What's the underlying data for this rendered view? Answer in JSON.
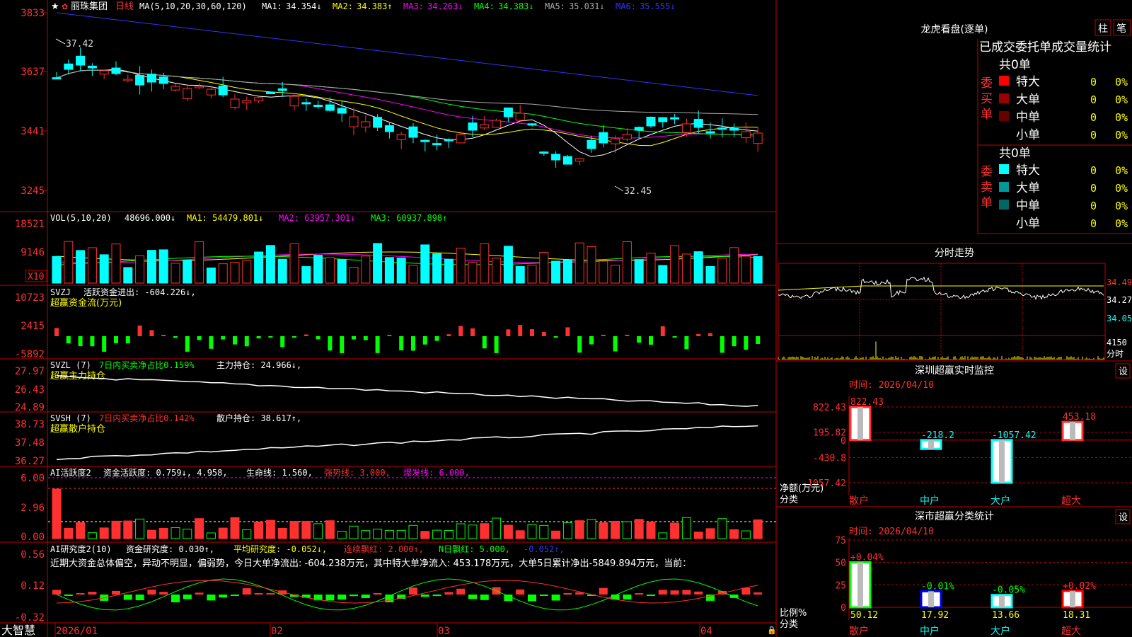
{
  "stock": {
    "name": "丽珠集团",
    "period": "日线",
    "star": "★"
  },
  "ma_header": {
    "label": "MA(5,10,20,30,60,120)",
    "items": [
      {
        "name": "MA1:",
        "value": "34.354↓",
        "color": "#ffffff"
      },
      {
        "name": "MA2:",
        "value": "34.383↑",
        "color": "#ffff00"
      },
      {
        "name": "MA3:",
        "value": "34.263↓",
        "color": "#ff00ff"
      },
      {
        "name": "MA4:",
        "value": "34.383↓",
        "color": "#00ff00"
      },
      {
        "name": "MA5:",
        "value": "35.031↓",
        "color": "#aaaaaa"
      },
      {
        "name": "MA6:",
        "value": "35.555↓",
        "color": "#3333ff"
      }
    ]
  },
  "price_axis": {
    "ticks": [
      "3833",
      "3637",
      "3441",
      "3245"
    ]
  },
  "price_annotations": {
    "high": "37.42",
    "low": "32.45"
  },
  "vol_header": {
    "label": "VOL(5,10,20)",
    "value": "48696.000↓",
    "ma1": "MA1: 54479.801↓",
    "ma2": "MA2: 63957.301↓",
    "ma3": "MA3: 60937.898↑"
  },
  "vol_axis": {
    "ticks": [
      "18521",
      "9146"
    ],
    "unit": "X10"
  },
  "svzj": {
    "label": "SVZJ",
    "desc": "活跃资金进出: -604.226↓,",
    "sub": "超赢资金流(万元)",
    "ticks": [
      "10723",
      "2415",
      "-5892"
    ]
  },
  "svzl": {
    "label": "SVZL (7)",
    "desc1": "7日内买卖净占比0.159%",
    "desc2": "主力持仓: 24.966↓,",
    "sub": "超赢主力持仓",
    "ticks": [
      "27.97",
      "26.43",
      "24.89"
    ]
  },
  "svsh": {
    "label": "SVSH (7)",
    "desc1": "7日内买卖净占比0.142%",
    "desc2": "散户持仓: 38.617↑,",
    "sub": "超赢散户持仓",
    "ticks": [
      "38.73",
      "37.48",
      "36.27"
    ]
  },
  "ai1": {
    "label": "AI活跃度2",
    "desc1": "资金活跃度: 0.759↓, 4.958,",
    "desc2": "生命线: 1.560,",
    "desc3": "强势线: 3.000,",
    "desc4": "爆发线: 6.000,",
    "ticks": [
      "6.00",
      "2.96",
      "0.00"
    ]
  },
  "ai2": {
    "label": "AI研究度2(10)",
    "desc1": "资金研究度: 0.030↑,",
    "desc2": "平均研究度: -0.052↓,",
    "desc3": "连续飘红: 2.000↑,",
    "desc4": "N日飘红: 5.000,",
    "desc5": "-0.052↑,",
    "ticks": [
      "0.56",
      "0.12",
      "-0.32"
    ]
  },
  "commentary": "近期大资金总体偏空，异动不明显，偏弱势，今日大单净流出: -604.238万元，其中特大单净流入: 453.178万元，大单5日累计净出-5849.894万元，当前：",
  "date_axis": {
    "brand": "大智慧",
    "labels": [
      "2026/01",
      "02",
      "03",
      "04"
    ]
  },
  "dragon": {
    "title": "龙虎看盘(逐单)",
    "tab1": "柱",
    "tab2": "笔",
    "subtitle": "已成交委托单成交量统计",
    "buy_label": "委买单",
    "sell_label": "委卖单",
    "buy_total": "共0单",
    "sell_total": "共0单",
    "buy_rows": [
      {
        "name": "特大",
        "count": "0",
        "pct": "0%",
        "color": "#ff0000"
      },
      {
        "name": "大单",
        "count": "0",
        "pct": "0%",
        "color": "#990000"
      },
      {
        "name": "中单",
        "count": "0",
        "pct": "0%",
        "color": "#660000"
      },
      {
        "name": "小单",
        "count": "0",
        "pct": "0%",
        "color": "#000000"
      }
    ],
    "sell_rows": [
      {
        "name": "特大",
        "count": "0",
        "pct": "0%",
        "color": "#00ffff"
      },
      {
        "name": "大单",
        "count": "0",
        "pct": "0%",
        "color": "#009999"
      },
      {
        "name": "中单",
        "count": "0",
        "pct": "0%",
        "color": "#006666"
      },
      {
        "name": "小单",
        "count": "0",
        "pct": "0%",
        "color": "#000000"
      }
    ]
  },
  "intraday": {
    "title": "分时走势",
    "prices": [
      "34.49",
      "34.27",
      "34.05"
    ],
    "vol": "4150",
    "vol_unit": "分时"
  },
  "monitor": {
    "title": "深圳超赢实时监控",
    "time": "时间: 2026/04/10",
    "set": "设",
    "ticks": [
      "822.43",
      "195.82",
      "0",
      "-430.8",
      "-1057.42"
    ],
    "ylabel1": "净额(万元)",
    "ylabel2": "分类",
    "bars": [
      {
        "cat": "散户",
        "value": 822.43,
        "label": "822.43"
      },
      {
        "cat": "中户",
        "value": -218.2,
        "label": "-218.2"
      },
      {
        "cat": "大户",
        "value": -1057.42,
        "label": "-1057.42"
      },
      {
        "cat": "超大",
        "value": 453.18,
        "label": "453.18"
      }
    ]
  },
  "classify": {
    "title": "深市超赢分类统计",
    "time": "时间: 2026/04/10",
    "set": "设",
    "ticks": [
      "75",
      "50",
      "25",
      "0"
    ],
    "ylabel1": "比例%",
    "ylabel2": "分类",
    "bars": [
      {
        "cat": "散户",
        "value": 50.12,
        "label": "50.12",
        "change": "+0.04%",
        "color": "#00ff00"
      },
      {
        "cat": "中户",
        "value": 17.92,
        "label": "17.92",
        "change": "-0.01%",
        "color": "#0000ff"
      },
      {
        "cat": "大户",
        "value": 13.66,
        "label": "13.66",
        "change": "-0.05%",
        "color": "#00ffff"
      },
      {
        "cat": "超大",
        "value": 18.31,
        "label": "18.31",
        "change": "+0.02%",
        "color": "#ff0000"
      }
    ]
  }
}
